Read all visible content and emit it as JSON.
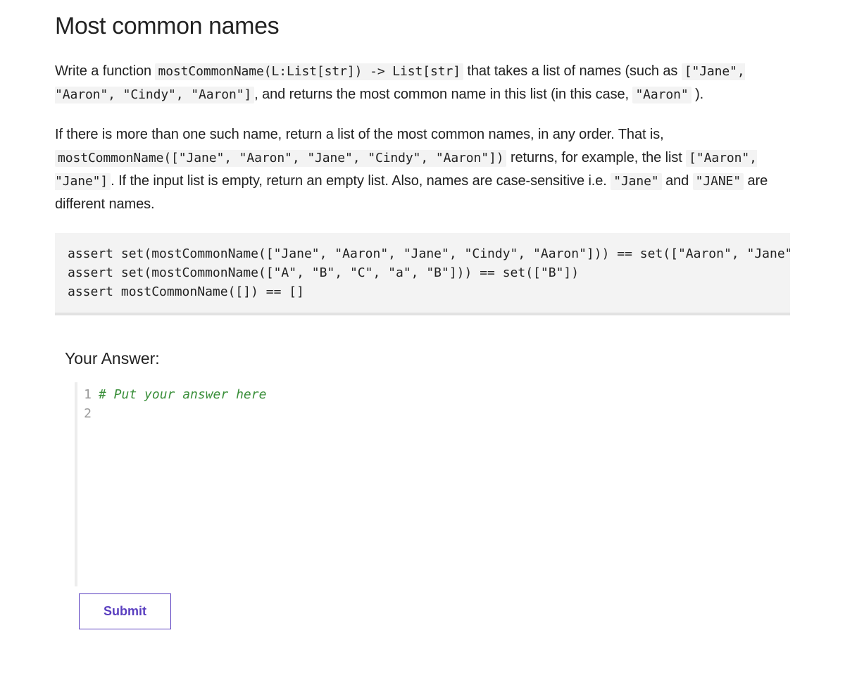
{
  "title": "Most common names",
  "para1": {
    "t1": "Write a function ",
    "c1": "mostCommonName(L:List[str]) -> List[str]",
    "t2": " that takes a list of names (such as ",
    "c2": "[\"Jane\", \"Aaron\", \"Cindy\", \"Aaron\"]",
    "t3": ", and returns the most common name in this list (in this case, ",
    "c3": "\"Aaron\"",
    "t4": " )."
  },
  "para2": {
    "t1": "If there is more than one such name, return a list of the most common names, in any order. That is, ",
    "c1": "mostCommonName([\"Jane\", \"Aaron\", \"Jane\", \"Cindy\", \"Aaron\"])",
    "t2": " returns, for example, the list ",
    "c2": "[\"Aaron\", \"Jane\"]",
    "t3": ". If the input list is empty, return an empty list. Also, names are case-sensitive i.e. ",
    "c3": "\"Jane\"",
    "t4": " and ",
    "c4": "\"JANE\"",
    "t5": " are different names."
  },
  "codeblock": "assert set(mostCommonName([\"Jane\", \"Aaron\", \"Jane\", \"Cindy\", \"Aaron\"])) == set([\"Aaron\", \"Jane\"])\nassert set(mostCommonName([\"A\", \"B\", \"C\", \"a\", \"B\"])) == set([\"B\"])\nassert mostCommonName([]) == []",
  "answer_heading": "Your Answer:",
  "editor": {
    "gutter": [
      "1",
      "2"
    ],
    "line1_comment": "# Put your answer here",
    "line2": ""
  },
  "submit_label": "Submit"
}
